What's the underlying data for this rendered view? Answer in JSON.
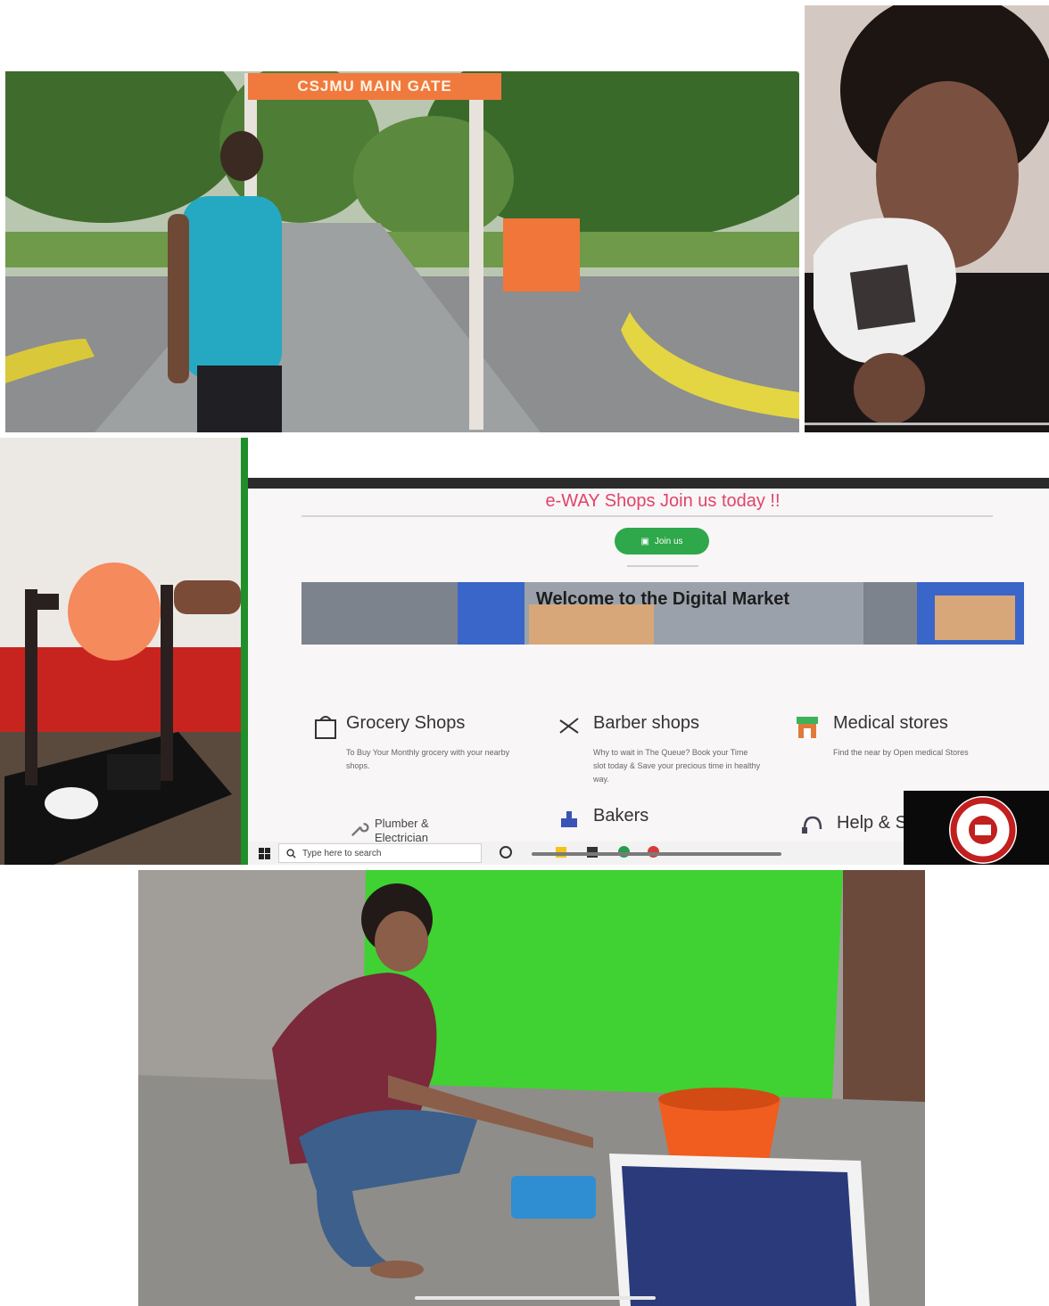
{
  "tile_gate": {
    "sign_text": "CSJMU MAIN GATE"
  },
  "tile_screen": {
    "heading": "e-WAY Shops Join us today !!",
    "join_button": "Join us",
    "banner_text": "Welcome to the Digital Market",
    "categories": [
      {
        "title": "Grocery Shops",
        "desc": "To Buy Your Monthly grocery with your nearby shops."
      },
      {
        "title": "Barber shops",
        "desc": "Why to wait in The Queue? Book your Time slot today & Save your precious time in healthy way."
      },
      {
        "title": "Medical stores",
        "desc": "Find the near by Open medical Stores"
      },
      {
        "title": "Plumber & Electrician",
        "desc": ""
      },
      {
        "title": "Bakers",
        "desc": ""
      },
      {
        "title": "Help & S",
        "desc": ""
      }
    ],
    "taskbar_search": "Type here to search"
  },
  "icons": {
    "grocery": "grocery-bag-icon",
    "barber": "scissors-icon",
    "medical": "storefront-icon",
    "plumber": "wrench-icon",
    "bakers": "cake-icon",
    "help": "support-headset-icon",
    "windows": "windows-start-icon",
    "search": "search-icon",
    "join": "bag-icon"
  },
  "colors": {
    "accent_pink": "#e0446a",
    "join_green": "#2ea84a",
    "gate_orange": "#f07a3e",
    "screen_green_border": "#1f8f2a"
  }
}
